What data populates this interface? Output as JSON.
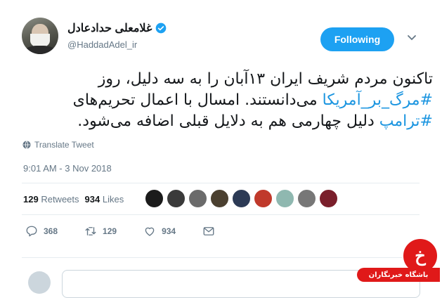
{
  "user": {
    "name": "غلامعلی حدادعادل",
    "handle": "@HaddadAdel_ir",
    "verified": true
  },
  "follow_button": {
    "label": "Following",
    "color": "#1da1f2"
  },
  "tweet": {
    "line1": "تاکنون مردم شریف ایران ۱۳آبان را به سه دلیل، روز",
    "hashtag1": "#مرگ_بر_آمریکا",
    "line2_rest": " می‌دانستند. امسال با اعمال تحریم‌های",
    "hashtag2": "#ترامپ",
    "line3_rest": " دلیل چهارمی هم به دلایل قبلی اضافه می‌شود."
  },
  "translate_label": "Translate Tweet",
  "timestamp": "9:01 AM - 3 Nov 2018",
  "stats": {
    "retweets_count": "129",
    "retweets_label": "Retweets",
    "likes_count": "934",
    "likes_label": "Likes"
  },
  "likers": [
    {
      "icon": "liker-avatar-1",
      "color": "#1b1b1b"
    },
    {
      "icon": "liker-avatar-2",
      "color": "#3a3a3a"
    },
    {
      "icon": "liker-avatar-3",
      "color": "#6b6b6b"
    },
    {
      "icon": "liker-avatar-4",
      "color": "#4b4030"
    },
    {
      "icon": "liker-avatar-5",
      "color": "#2c3a55"
    },
    {
      "icon": "liker-avatar-6",
      "color": "#c0392b"
    },
    {
      "icon": "liker-avatar-7",
      "color": "#8fb8b0"
    },
    {
      "icon": "liker-avatar-8",
      "color": "#777777"
    },
    {
      "icon": "liker-avatar-9",
      "color": "#7a1f2b"
    }
  ],
  "actions": {
    "reply_count": "368",
    "retweet_count": "129",
    "like_count": "934"
  },
  "badge": {
    "glyph": "خ",
    "label": "باشگاه خبرنگاران",
    "color": "#e01919"
  }
}
